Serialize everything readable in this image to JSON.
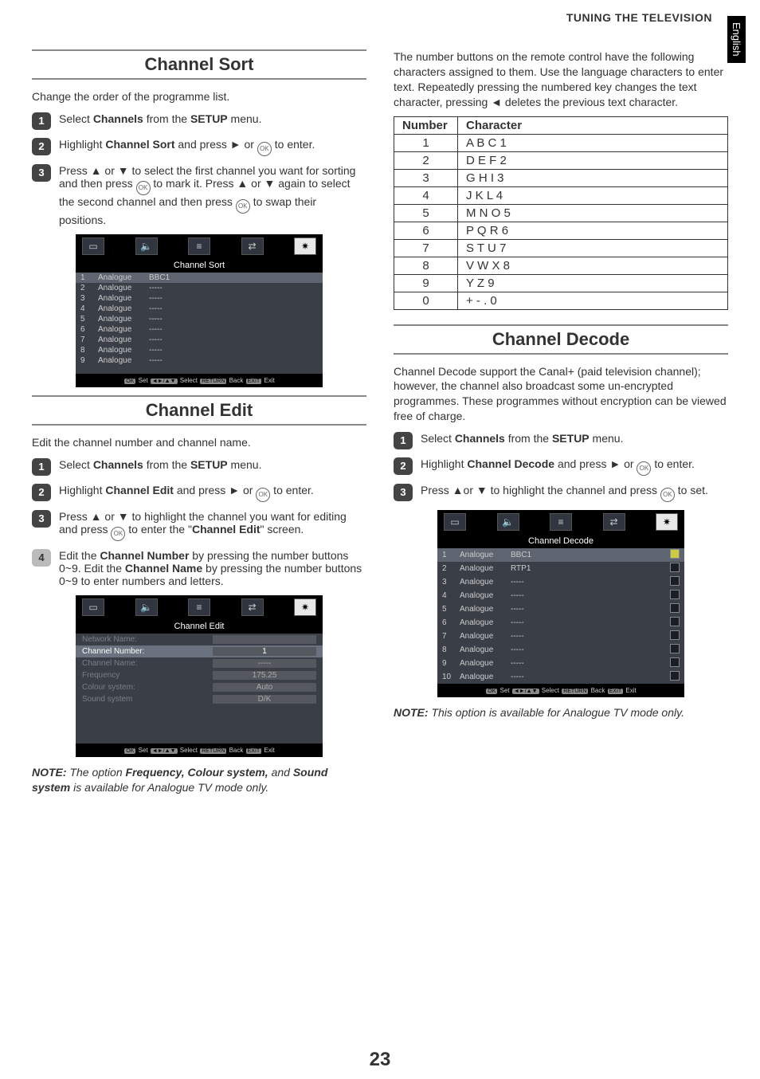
{
  "header": {
    "section_title": "TUNING THE TELEVISION",
    "lang_tab": "English"
  },
  "left": {
    "h_sort": "Channel Sort",
    "sort_intro": "Change the order of the programme list.",
    "sort_step1": "Select Channels from the SETUP menu.",
    "sort_step2": "Highlight Channel Sort and press ► or ⊙ to enter.",
    "sort_step3": "Press ▲ or ▼ to select the first channel you want for sorting and then press ⊙ to mark it. Press ▲ or ▼ again to select the second channel and then press ⊙ to swap their positions.",
    "h_edit": "Channel Edit",
    "edit_intro": "Edit the channel number and channel name.",
    "edit_step1": "Select Channels from the SETUP menu.",
    "edit_step2": "Highlight Channel Edit and press ► or ⊙ to enter.",
    "edit_step3": "Press ▲ or ▼ to highlight the channel you want for editing and press ⊙ to enter the \"Channel Edit\" screen.",
    "edit_step4": "Edit the Channel Number by pressing the number buttons 0~9. Edit the Channel Name by pressing the number buttons 0~9 to enter numbers and letters.",
    "note": "NOTE: The option Frequency, Colour system, and Sound system is available for Analogue TV mode only."
  },
  "right": {
    "intro": "The number buttons on the remote control have the following characters assigned to them. Use the language characters to enter text. Repeatedly pressing the numbered key changes the text character, pressing ◄ deletes the previous text character.",
    "table_head": {
      "c1": "Number",
      "c2": "Character"
    },
    "table_rows": [
      {
        "n": "1",
        "c": "A B C 1"
      },
      {
        "n": "2",
        "c": "D E F 2"
      },
      {
        "n": "3",
        "c": "G H I 3"
      },
      {
        "n": "4",
        "c": "J K L 4"
      },
      {
        "n": "5",
        "c": "M N O 5"
      },
      {
        "n": "6",
        "c": "P Q R 6"
      },
      {
        "n": "7",
        "c": "S T U 7"
      },
      {
        "n": "8",
        "c": "V W X 8"
      },
      {
        "n": "9",
        "c": "Y Z 9"
      },
      {
        "n": "0",
        "c": "+ - . 0"
      }
    ],
    "h_decode": "Channel Decode",
    "decode_intro": "Channel Decode support the Canal+ (paid television channel); however, the channel also broadcast some un-encrypted programmes. These programmes without encryption can be viewed free of charge.",
    "decode_step1": "Select Channels from the SETUP menu.",
    "decode_step2": "Highlight Channel Decode and press ► or ⊙ to enter.",
    "decode_step3": "Press ▲or ▼ to highlight the channel and press ⊙ to set.",
    "note": "NOTE: This option is available for Analogue TV mode only."
  },
  "osd": {
    "sort_title": "Channel Sort",
    "edit_title": "Channel Edit",
    "decode_title": "Channel Decode",
    "foot": "OK Set ◄►/▲▼ Select RETURN Back EXIT Exit",
    "analogue": "Analogue",
    "dashes": "-----",
    "bbc1": "BBC1",
    "rtp1": "RTP1",
    "edit_rows": {
      "network": "Network Name:",
      "chnum": "Channel Number:",
      "chnum_v": "1",
      "chname": "Channel Name:",
      "chname_v": "-----",
      "freq": "Frequency",
      "freq_v": "175.25",
      "colour": "Colour system:",
      "colour_v": "Auto",
      "sound": "Sound system",
      "sound_v": "D/K"
    }
  },
  "page_number": "23"
}
